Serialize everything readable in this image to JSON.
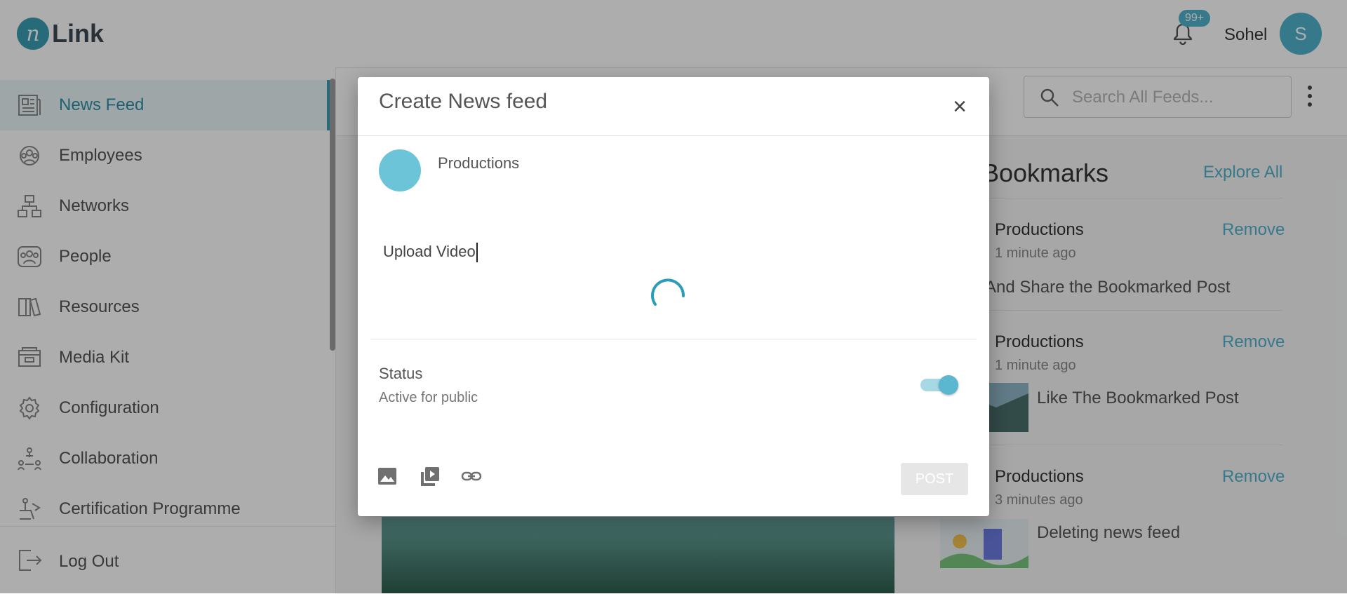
{
  "app": {
    "brand_mark": "n",
    "brand_word": "Link"
  },
  "header": {
    "notification_badge": "99+",
    "username": "Sohel",
    "avatar_initial": "S"
  },
  "sidebar": {
    "items": [
      {
        "label": "News Feed",
        "icon": "newspaper-icon",
        "active": true
      },
      {
        "label": "Employees",
        "icon": "employees-icon"
      },
      {
        "label": "Networks",
        "icon": "network-icon"
      },
      {
        "label": "People",
        "icon": "people-icon"
      },
      {
        "label": "Resources",
        "icon": "book-icon"
      },
      {
        "label": "Media Kit",
        "icon": "media-kit-icon"
      },
      {
        "label": "Configuration",
        "icon": "gear-icon"
      },
      {
        "label": "Collaboration",
        "icon": "collaboration-icon"
      },
      {
        "label": "Certification Programme",
        "icon": "certification-icon"
      }
    ],
    "logout_label": "Log Out"
  },
  "search": {
    "placeholder": "Search All Feeds..."
  },
  "bookmarks": {
    "title": "Bookmarks",
    "explore_label": "Explore All",
    "remove_label": "Remove",
    "items": [
      {
        "name": "Productions",
        "time": "1 minute ago",
        "text": "And Share the Bookmarked Post"
      },
      {
        "name": "Productions",
        "time": "1 minute ago",
        "text": "Like The Bookmarked Post"
      },
      {
        "name": "Productions",
        "time": "3 minutes ago",
        "text": "Deleting news feed"
      }
    ]
  },
  "modal": {
    "title": "Create News feed",
    "close_label": "×",
    "author_name": "Productions",
    "post_text": "Upload Video",
    "status_label": "Status",
    "status_sub": "Active for public",
    "status_on": true,
    "post_button": "POST",
    "tools": [
      "image-icon",
      "video-icon",
      "link-icon"
    ]
  },
  "colors": {
    "accent": "#4fb3cc",
    "overlay": "rgba(0,0,0,0.32)"
  }
}
